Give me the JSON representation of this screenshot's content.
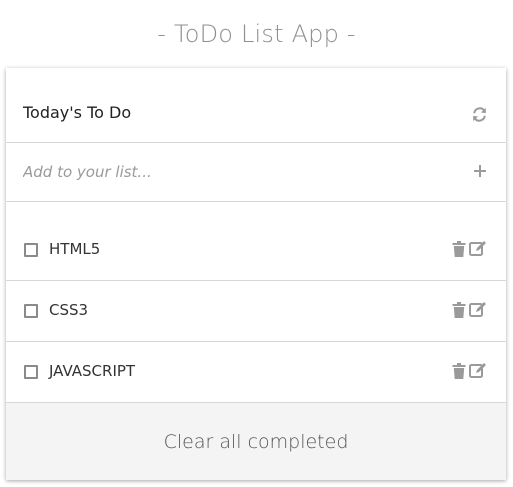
{
  "app": {
    "title": "- ToDo List App -"
  },
  "header": {
    "title": "Today's To Do",
    "refresh_icon": "refresh-icon"
  },
  "add": {
    "placeholder": "Add to your list...",
    "value": "",
    "add_icon": "plus-icon"
  },
  "items": [
    {
      "label": "HTML5",
      "checked": false
    },
    {
      "label": "CSS3",
      "checked": false
    },
    {
      "label": "JAVASCRIPT",
      "checked": false
    }
  ],
  "footer": {
    "clear_label": "Clear all completed"
  },
  "colors": {
    "title": "#8f8f8f",
    "icon": "#9a9a9a",
    "divider": "#d6d6d6",
    "footer_bg": "#f4f4f4"
  }
}
